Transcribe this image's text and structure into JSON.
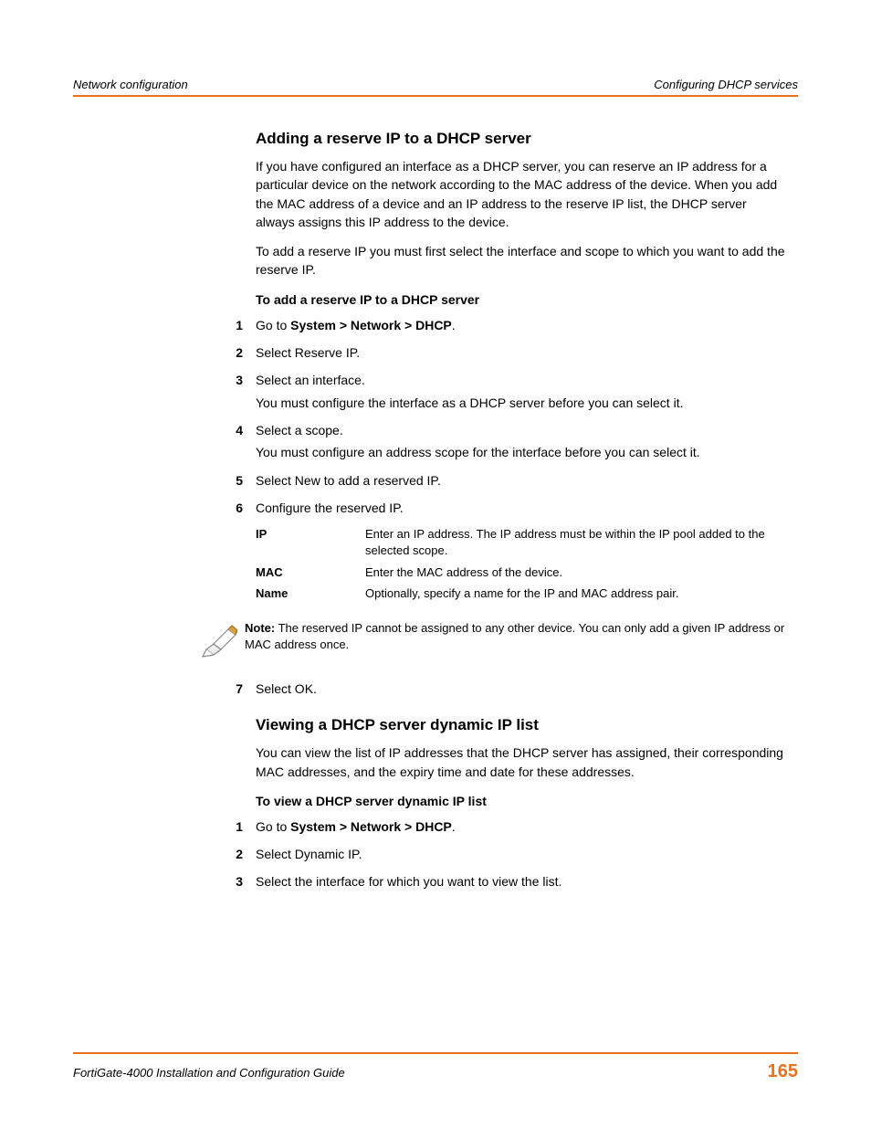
{
  "header": {
    "left": "Network configuration",
    "right": "Configuring DHCP services"
  },
  "section1": {
    "title": "Adding a reserve IP to a DHCP server",
    "para1": "If you have configured an interface as a DHCP server, you can reserve an IP address for a particular device on the network according to the MAC address of the device. When you add the MAC address of a device and an IP address to the reserve IP list, the DHCP server always assigns this IP address to the device.",
    "para2": "To add a reserve IP you must first select the interface and scope to which you want to add the reserve IP.",
    "subhead": "To add a reserve IP to a DHCP server",
    "steps": [
      {
        "n": "1",
        "text_pre": "Go to ",
        "bold": "System > Network > DHCP",
        "text_post": "."
      },
      {
        "n": "2",
        "text": "Select Reserve IP."
      },
      {
        "n": "3",
        "text": "Select an interface.",
        "sub": "You must configure the interface as a DHCP server before you can select it."
      },
      {
        "n": "4",
        "text": "Select a scope.",
        "sub": "You must configure an address scope for the interface before you can select it."
      },
      {
        "n": "5",
        "text": "Select New to add a reserved IP."
      },
      {
        "n": "6",
        "text": "Configure the reserved IP."
      }
    ],
    "defs": [
      {
        "term": "IP",
        "desc": "Enter an IP address. The IP address must be within the IP pool added to the selected scope."
      },
      {
        "term": "MAC",
        "desc": "Enter the MAC address of the device."
      },
      {
        "term": "Name",
        "desc": "Optionally, specify a name for the IP and MAC address pair."
      }
    ],
    "note_label": "Note:",
    "note_text": " The reserved IP cannot be assigned to any other device. You can only add a given IP address or MAC address once.",
    "step7": {
      "n": "7",
      "text": "Select OK."
    }
  },
  "section2": {
    "title": "Viewing a DHCP server dynamic IP list",
    "para1": "You can view the list of IP addresses that the DHCP server has assigned, their corresponding MAC addresses, and the expiry time and date for these addresses.",
    "subhead": "To view a DHCP server dynamic IP list",
    "steps": [
      {
        "n": "1",
        "text_pre": "Go to ",
        "bold": "System > Network > DHCP",
        "text_post": "."
      },
      {
        "n": "2",
        "text": "Select Dynamic IP."
      },
      {
        "n": "3",
        "text": "Select the interface for which you want to view the list."
      }
    ]
  },
  "footer": {
    "left": "FortiGate-4000 Installation and Configuration Guide",
    "page": "165"
  }
}
